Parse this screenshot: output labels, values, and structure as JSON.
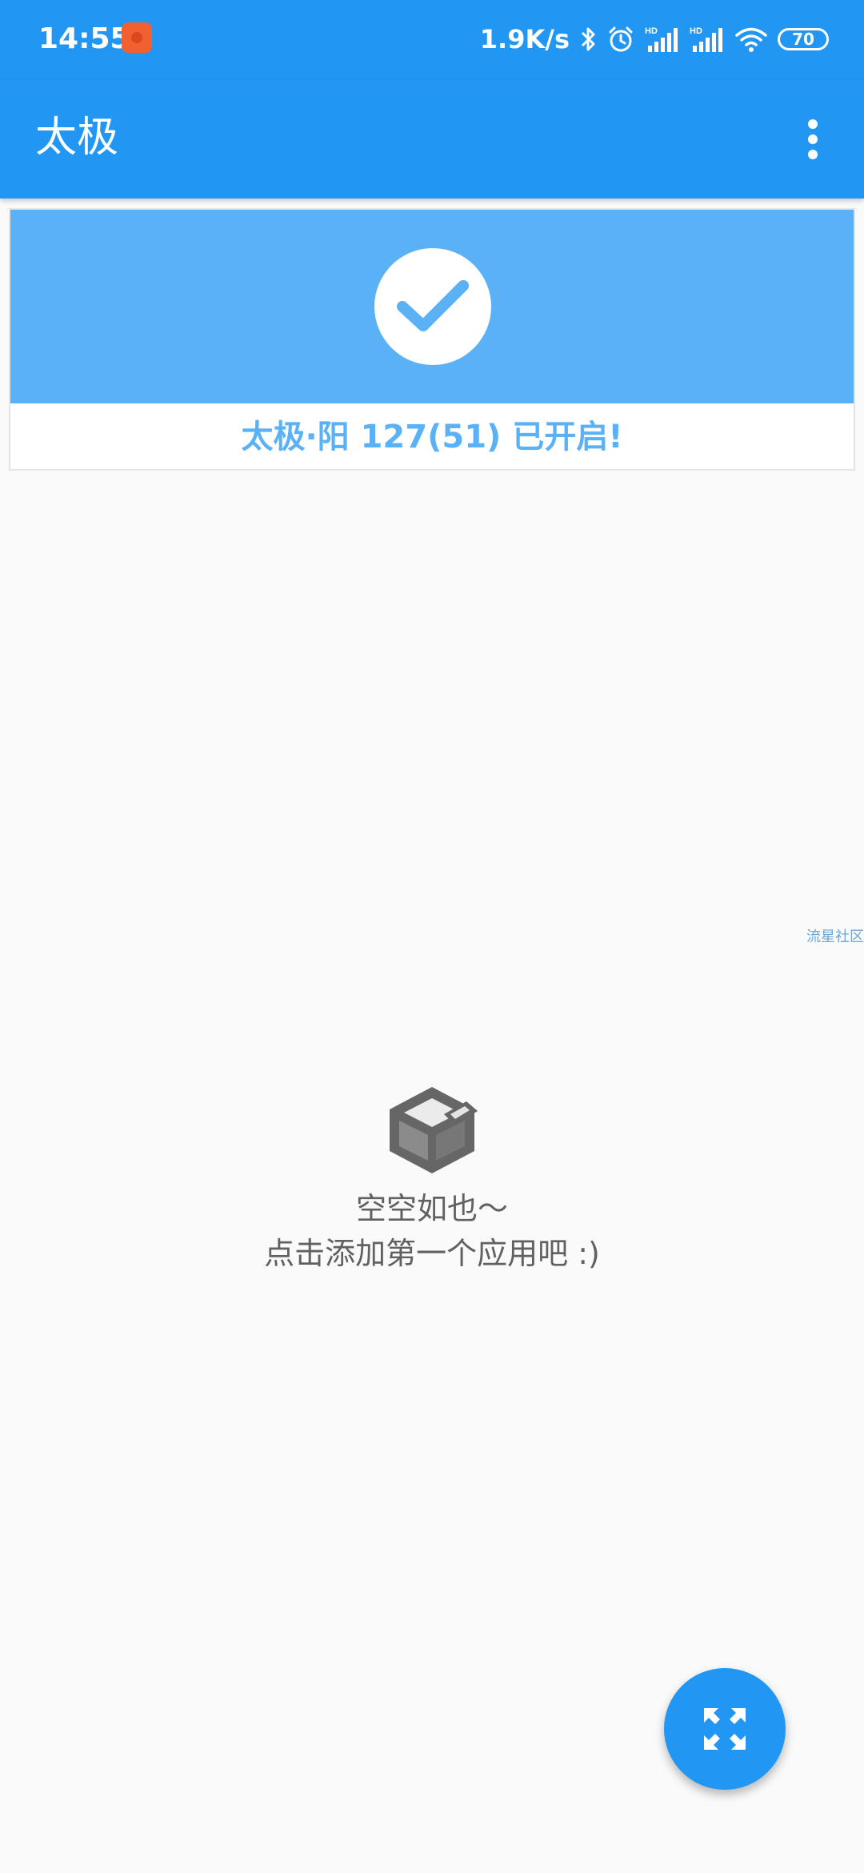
{
  "status_bar": {
    "time": "14:55",
    "net_speed": "1.9K/s",
    "battery": "70",
    "signal_badge": "HD",
    "icons": [
      "app-notification-icon",
      "bluetooth-icon",
      "alarm-icon",
      "signal-hd-icon",
      "signal-hd-icon",
      "wifi-icon",
      "battery-icon"
    ]
  },
  "app_bar": {
    "title": "太极",
    "menu_icon": "overflow-menu-icon"
  },
  "status_card": {
    "text": "太极·阳 127(51) 已开启!",
    "icon": "check-icon"
  },
  "watermark": "流星社区",
  "empty_state": {
    "icon": "empty-box-icon",
    "title": "空空如也～",
    "subtitle": "点击添加第一个应用吧 :)"
  },
  "fab": {
    "icon": "expand-arrows-icon"
  },
  "colors": {
    "primary": "#2196F3",
    "card_accent": "#5AB1F5",
    "background": "#fafafa",
    "empty_text": "#616161"
  }
}
